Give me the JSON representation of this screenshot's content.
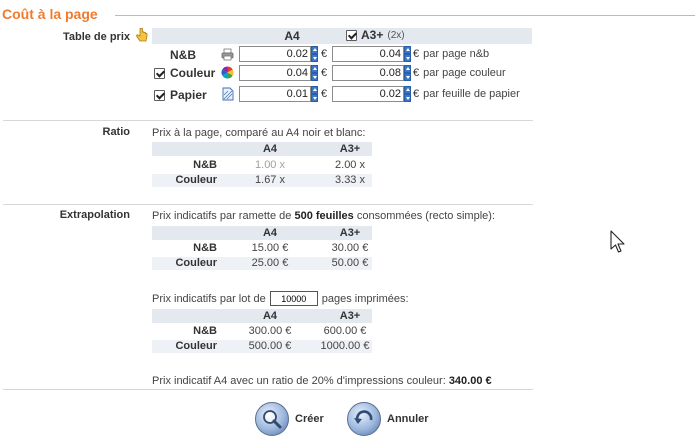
{
  "legend": "Coût à la page",
  "labels": {
    "price_table": "Table de prix",
    "ratio": "Ratio",
    "extrapolation": "Extrapolation"
  },
  "price_table": {
    "col_a4": "A4",
    "col_a3": "A3+",
    "a3_multiplier": "(2x)",
    "a3_checked": true,
    "currency": "€",
    "rows": [
      {
        "label": "N&B",
        "icon": "printer-icon",
        "has_checkbox": false,
        "a4": "0.02",
        "a3": "0.04",
        "unit": "par page n&b"
      },
      {
        "label": "Couleur",
        "icon": "color-wheel-icon",
        "has_checkbox": true,
        "checked": true,
        "a4": "0.04",
        "a3": "0.08",
        "unit": "par page couleur"
      },
      {
        "label": "Papier",
        "icon": "paper-icon",
        "has_checkbox": true,
        "checked": true,
        "a4": "0.01",
        "a3": "0.02",
        "unit": "par feuille de papier"
      }
    ]
  },
  "ratio": {
    "intro": "Prix à la page, comparé au A4 noir et blanc:",
    "cols": [
      "A4",
      "A3+"
    ],
    "rows": [
      {
        "label": "N&B",
        "a4": "1.00 x",
        "a3": "2.00 x"
      },
      {
        "label": "Couleur",
        "a4": "1.67 x",
        "a3": "3.33 x"
      }
    ]
  },
  "extrapolation": {
    "ream_intro_pre": "Prix indicatifs par ramette de ",
    "ream_intro_bold": "500 feuilles",
    "ream_intro_post": " consommées (recto simple):",
    "ream_cols": [
      "A4",
      "A3+"
    ],
    "ream_rows": [
      {
        "label": "N&B",
        "a4": "15.00 €",
        "a3": "30.00 €"
      },
      {
        "label": "Couleur",
        "a4": "25.00 €",
        "a3": "50.00 €"
      }
    ],
    "lot_intro_pre": "Prix indicatifs par lot de",
    "lot_value": "10000",
    "lot_intro_post": "pages imprimées:",
    "lot_cols": [
      "A4",
      "A3+"
    ],
    "lot_rows": [
      {
        "label": "N&B",
        "a4": "300.00 €",
        "a3": "600.00 €"
      },
      {
        "label": "Couleur",
        "a4": "500.00 €",
        "a3": "1000.00 €"
      }
    ],
    "summary_pre": "Prix indicatif A4 avec un ratio de 20% d'impressions couleur: ",
    "summary_bold": "340.00 €"
  },
  "buttons": {
    "create": "Créer",
    "cancel": "Annuler"
  },
  "colors": {
    "legend": "#f07b2c",
    "spinner": "#3a77c8",
    "header_band": "#e4e9f0"
  }
}
